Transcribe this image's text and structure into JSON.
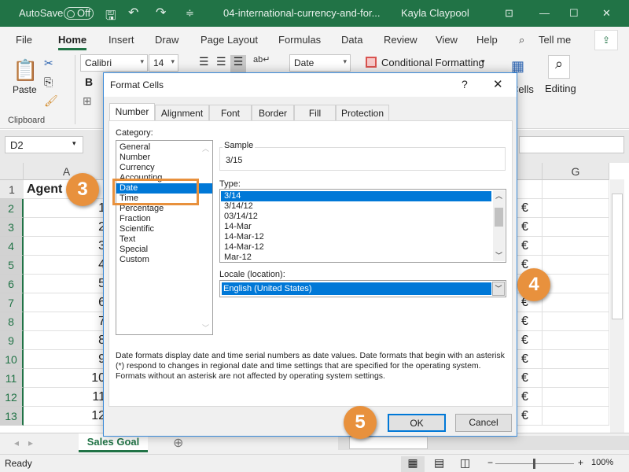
{
  "titlebar": {
    "autosave": "AutoSave",
    "autosave_state": "Off",
    "filename": "04-international-currency-and-for...",
    "user": "Kayla Claypool"
  },
  "ribbon_tabs": [
    "File",
    "Home",
    "Insert",
    "Draw",
    "Page Layout",
    "Formulas",
    "Data",
    "Review",
    "View",
    "Help",
    "Tell me"
  ],
  "ribbon": {
    "paste": "Paste",
    "clipboard": "Clipboard",
    "font": "Calibri",
    "size": "14",
    "bold": "B",
    "number_format": "Date",
    "conditional_formatting": "Conditional Formatting",
    "cells": "Cells",
    "editing": "Editing"
  },
  "formula_bar": {
    "name_box": "D2"
  },
  "grid": {
    "col_a": "A",
    "col_g": "G",
    "rows": [
      "1",
      "2",
      "3",
      "4",
      "5",
      "6",
      "7",
      "8",
      "9",
      "10",
      "11",
      "12",
      "13"
    ],
    "col_a_values": [
      "Agent",
      "1",
      "2",
      "3",
      "4",
      "5",
      "6",
      "7",
      "8",
      "9",
      "10",
      "11",
      "12"
    ],
    "currency_symbol": "€"
  },
  "sheet_tab": "Sales Goal",
  "status": {
    "ready": "Ready",
    "zoom": "100%"
  },
  "dialog": {
    "title": "Format Cells",
    "help": "?",
    "close": "✕",
    "tabs": [
      "Number",
      "Alignment",
      "Font",
      "Border",
      "Fill",
      "Protection"
    ],
    "category_label": "Category:",
    "categories": [
      "General",
      "Number",
      "Currency",
      "Accounting",
      "Date",
      "Time",
      "Percentage",
      "Fraction",
      "Scientific",
      "Text",
      "Special",
      "Custom"
    ],
    "selected_category": "Date",
    "sample_label": "Sample",
    "sample_value": "3/15",
    "type_label": "Type:",
    "types": [
      "3/14",
      "3/14/12",
      "03/14/12",
      "14-Mar",
      "14-Mar-12",
      "14-Mar-12",
      "Mar-12"
    ],
    "locale_label": "Locale (location):",
    "locale_value": "English (United States)",
    "description": "Date formats display date and time serial numbers as date values.  Date formats that begin with an asterisk (*) respond to changes in regional date and time settings that are specified for the operating system. Formats without an asterisk are not affected by operating system settings.",
    "ok": "OK",
    "cancel": "Cancel"
  },
  "callouts": [
    "3",
    "4",
    "5"
  ],
  "colors": {
    "excel_green": "#217346",
    "selection_blue": "#0078d7",
    "callout_orange": "#e8913d"
  }
}
